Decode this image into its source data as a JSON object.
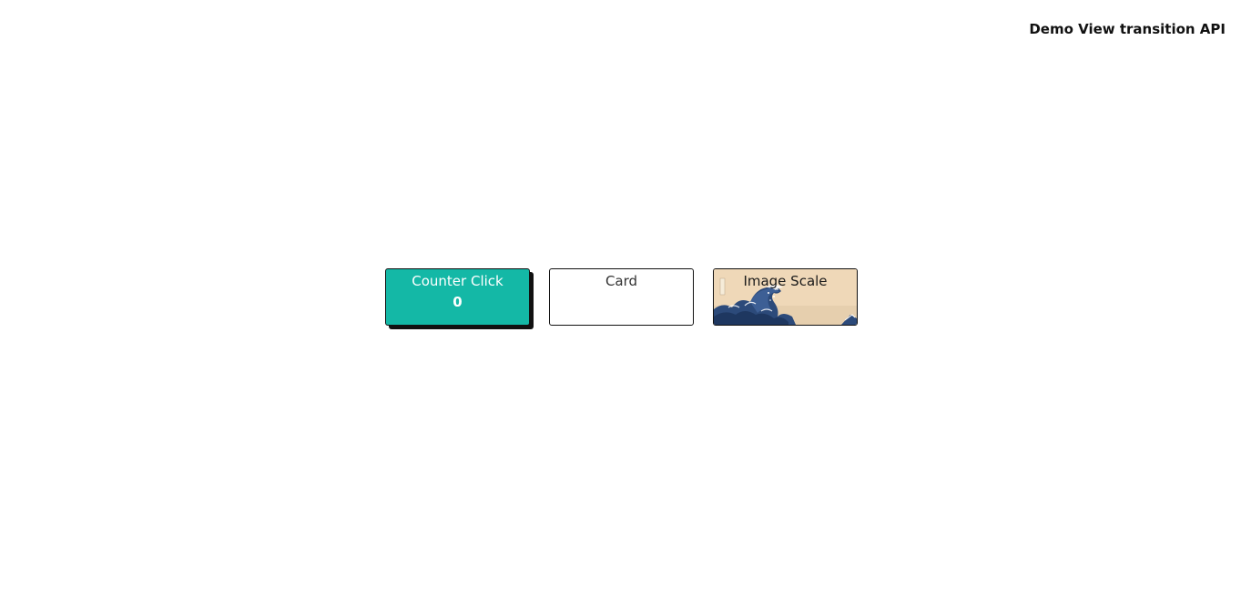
{
  "header": {
    "title": "Demo View transition API"
  },
  "cards": {
    "counter": {
      "label": "Counter Click",
      "value": "0",
      "color": "#14b8a6"
    },
    "card": {
      "label": "Card"
    },
    "image": {
      "label": "Image Scale",
      "image_subject": "great-wave-woodblock-print"
    }
  }
}
